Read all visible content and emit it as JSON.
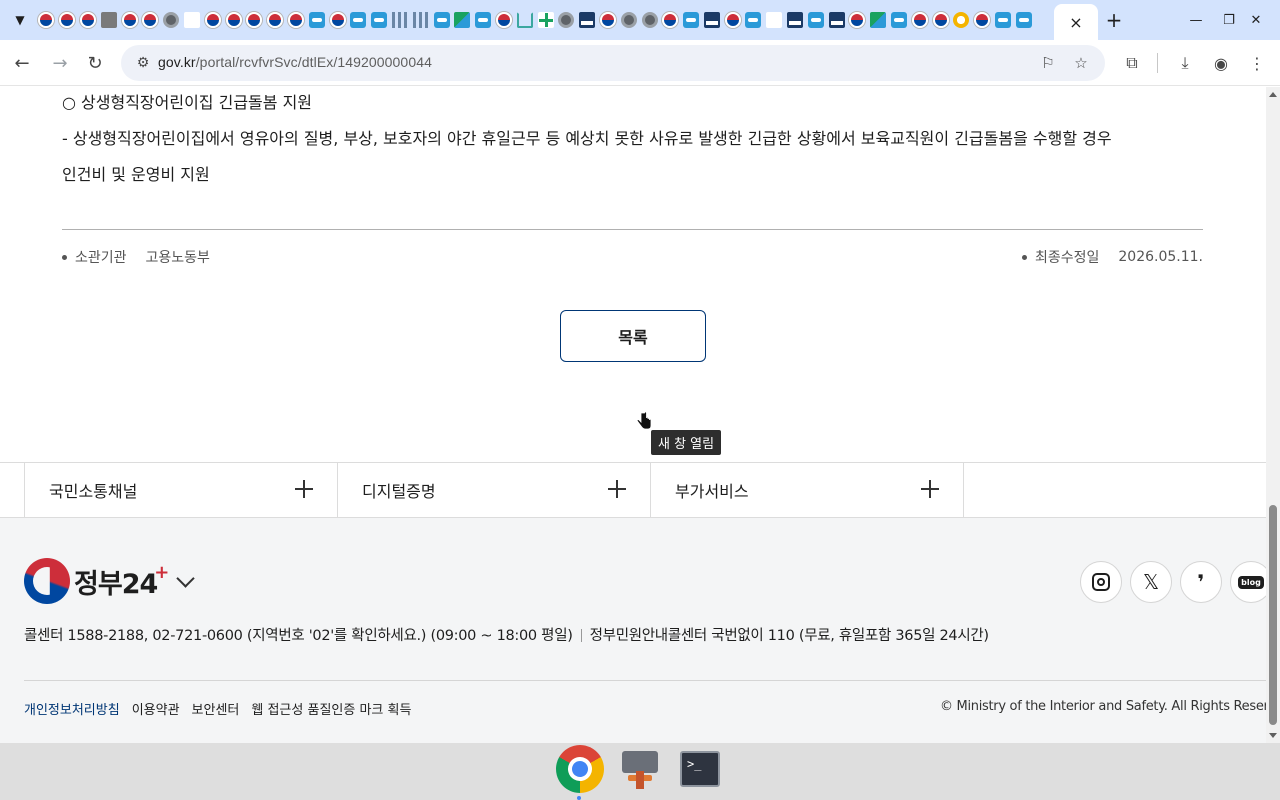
{
  "browser": {
    "url_domain": "gov.kr",
    "url_path": "/portal/rcvfvrSvc/dtlEx/149200000044",
    "active_tab_close": "×",
    "new_tab": "+",
    "pinned_tab_icons": [
      "gov-icon",
      "gov-icon",
      "gov-icon",
      "folder-icon",
      "gov-icon",
      "gov-icon",
      "globe-icon",
      "text-icon",
      "gov-icon",
      "gov-icon",
      "gov-icon",
      "gov-icon",
      "gov-icon",
      "blue-doc-icon",
      "gov-icon",
      "blue-doc-icon",
      "blue-doc-icon",
      "bars-icon",
      "bars-icon",
      "blue-doc-icon",
      "mixed-icon",
      "blue-doc-icon",
      "gov-icon",
      "house-icon",
      "green-plus-icon",
      "globe-icon",
      "navy-icon",
      "gov-icon",
      "globe-icon",
      "globe-icon",
      "gov-icon",
      "blue-doc-icon",
      "navy-icon",
      "gov-icon",
      "blue-doc-icon",
      "text-icon",
      "navy-icon",
      "blue-doc-icon",
      "navy-icon",
      "gov-icon",
      "mixed-icon",
      "blue-doc-icon",
      "gov-icon",
      "gov-icon",
      "orange-icon",
      "gov-icon",
      "blue-doc-icon",
      "blue-doc-icon"
    ]
  },
  "content": {
    "line1": "○ 상생형직장어린이집 긴급돌봄 지원",
    "line2": "- 상생형직장어린이집에서 영유아의 질병, 부상, 보호자의 야간 휴일근무 등 예상치 못한 사유로 발생한 긴급한 상황에서 보육교직원이 긴급돌봄을 수행할 경우",
    "line3": "인건비 및 운영비 지원",
    "agency_label": "소관기관",
    "agency_value": "고용노동부",
    "modified_label": "최종수정일",
    "modified_value": "2026.05.11.",
    "list_button": "목록"
  },
  "accordion": [
    {
      "label": "국민소통채널"
    },
    {
      "label": "디지털증명"
    },
    {
      "label": "부가서비스"
    }
  ],
  "tooltip": "새 창 열림",
  "footer": {
    "logo_text": "정부",
    "logo_num": "24",
    "logo_plus": "+",
    "contact_main": "콜센터 1588-2188, 02-721-0600 (지역번호 '02'를 확인하세요.) (09:00 ~ 18:00 평일)",
    "contact_sub": "정부민원안내콜센터 국번없이 110 (무료, 휴일포함 365일 24시간)",
    "links": [
      "개인정보처리방침",
      "이용약관",
      "보안센터",
      "웹 접근성 품질인증 마크 획득"
    ],
    "copyright": "© Ministry of the Interior and Safety. All Rights Reserved.",
    "social": [
      "instagram-icon",
      "x-icon",
      "kakao-story-icon",
      "blog-icon"
    ],
    "blog_label": "blog"
  },
  "taskbar": {
    "apps": [
      "chrome-icon",
      "tool-icon",
      "terminal-icon"
    ],
    "terminal_prompt": ">_"
  },
  "colors": {
    "tabstrip": "#d3e3fd",
    "accent_navy": "#003675",
    "gov_red": "#cd2e3a",
    "gov_blue": "#0047a0"
  }
}
